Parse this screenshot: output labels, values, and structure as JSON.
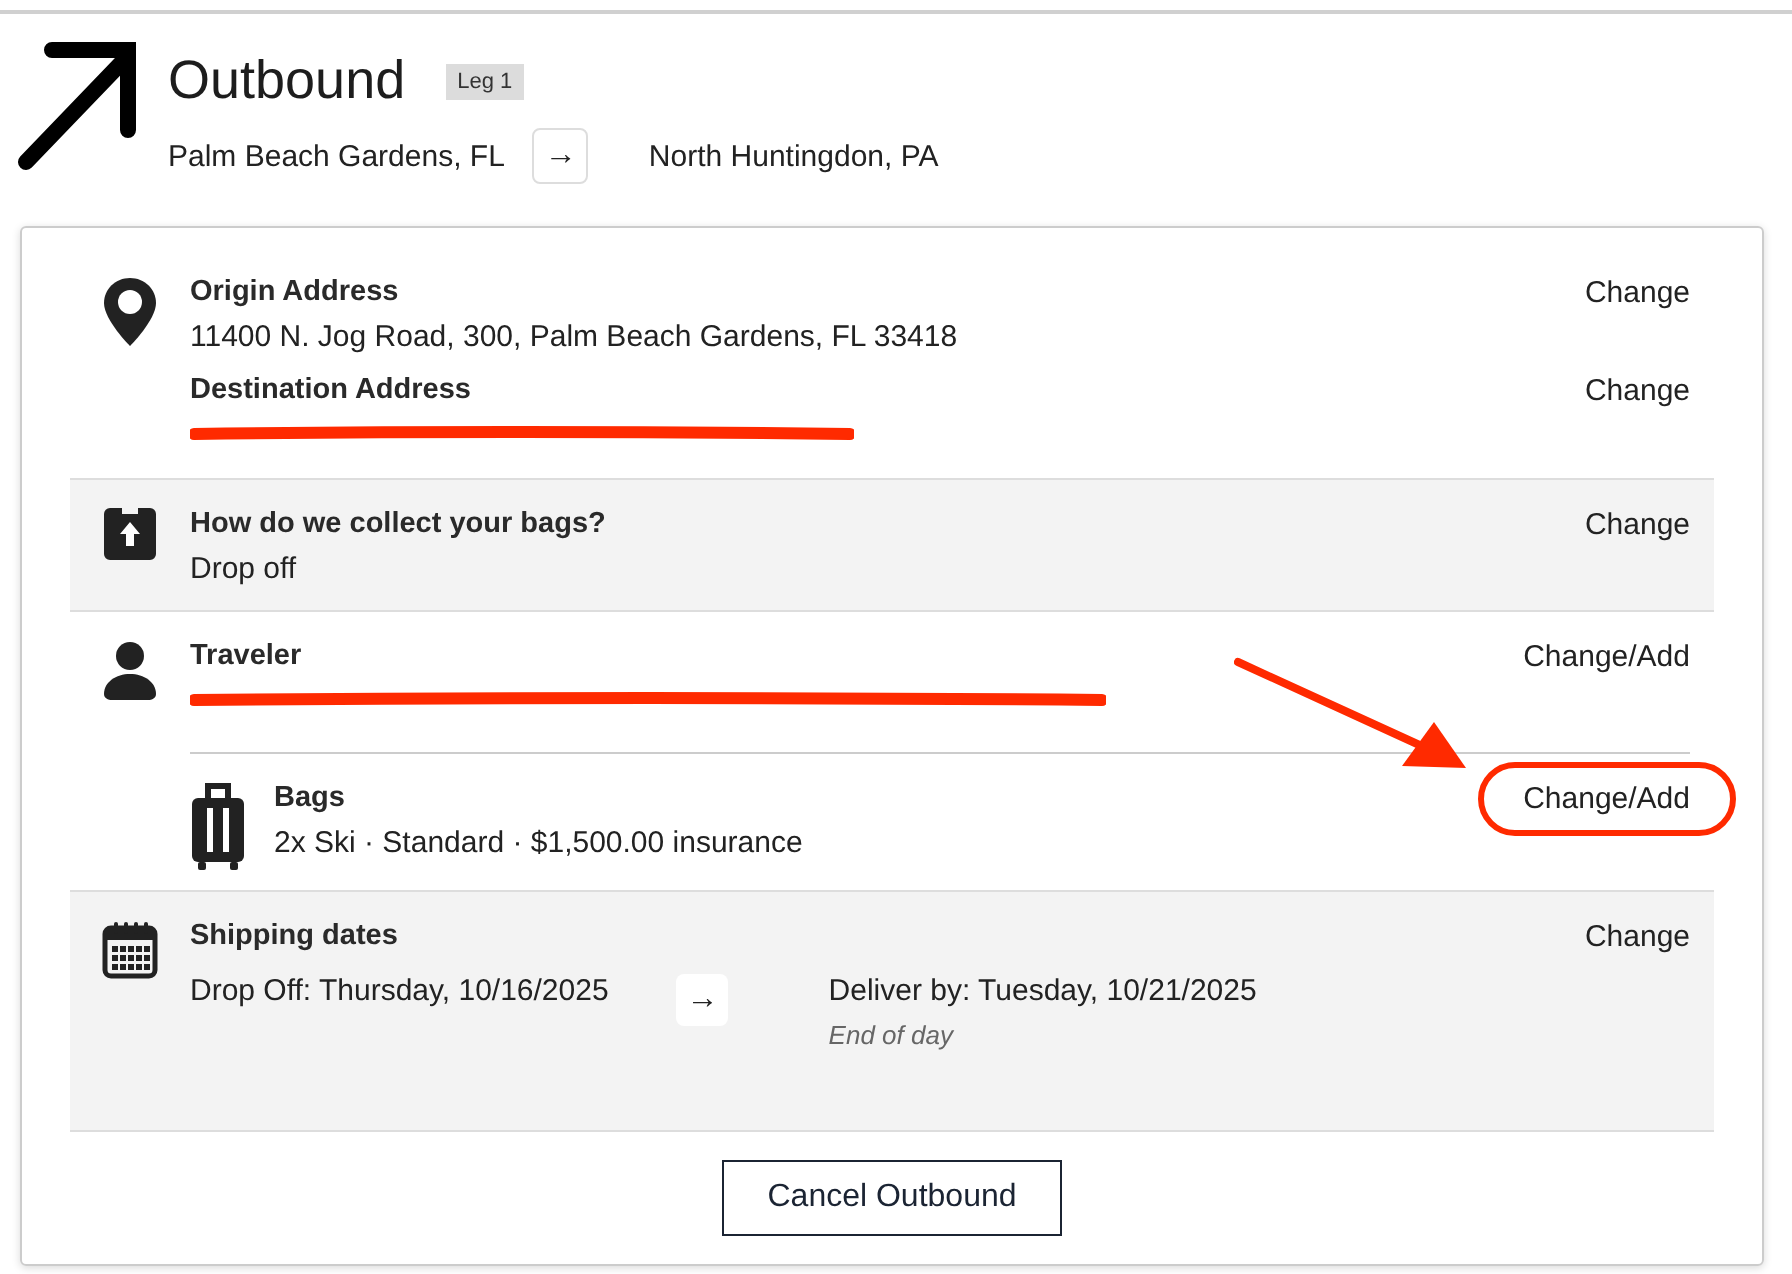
{
  "header": {
    "title": "Outbound",
    "badge": "Leg 1",
    "from": "Palm Beach Gardens, FL",
    "arrow": "→",
    "to": "North Huntingdon, PA"
  },
  "sections": [
    {
      "kind": "address",
      "shaded": false,
      "entries": [
        {
          "label": "Origin Address",
          "value": "11400 N. Jog Road, 300, Palm Beach Gardens, FL 33418",
          "redacted": false,
          "action": "Change"
        },
        {
          "label": "Destination Address",
          "redacted": true,
          "action": "Change"
        }
      ]
    },
    {
      "kind": "collect",
      "shaded": true,
      "entries": [
        {
          "label": "How do we collect your bags?",
          "value": "Drop off",
          "redacted": false,
          "action": "Change"
        }
      ]
    },
    {
      "kind": "traveler",
      "shaded": false,
      "entries": [
        {
          "label": "Traveler",
          "redacted": true,
          "action": "Change/Add"
        }
      ],
      "sub": {
        "label": "Bags",
        "value": "2x Ski · Standard · $1,500.00 insurance",
        "action": "Change/Add",
        "highlighted": true
      }
    },
    {
      "kind": "dates",
      "shaded": true,
      "label": "Shipping dates",
      "action": "Change",
      "drop": "Drop Off: Thursday, 10/16/2025",
      "arrow": "→",
      "deliver": "Deliver by: Tuesday, 10/21/2025",
      "note": "End of day"
    }
  ],
  "cancel_button": "Cancel Outbound"
}
